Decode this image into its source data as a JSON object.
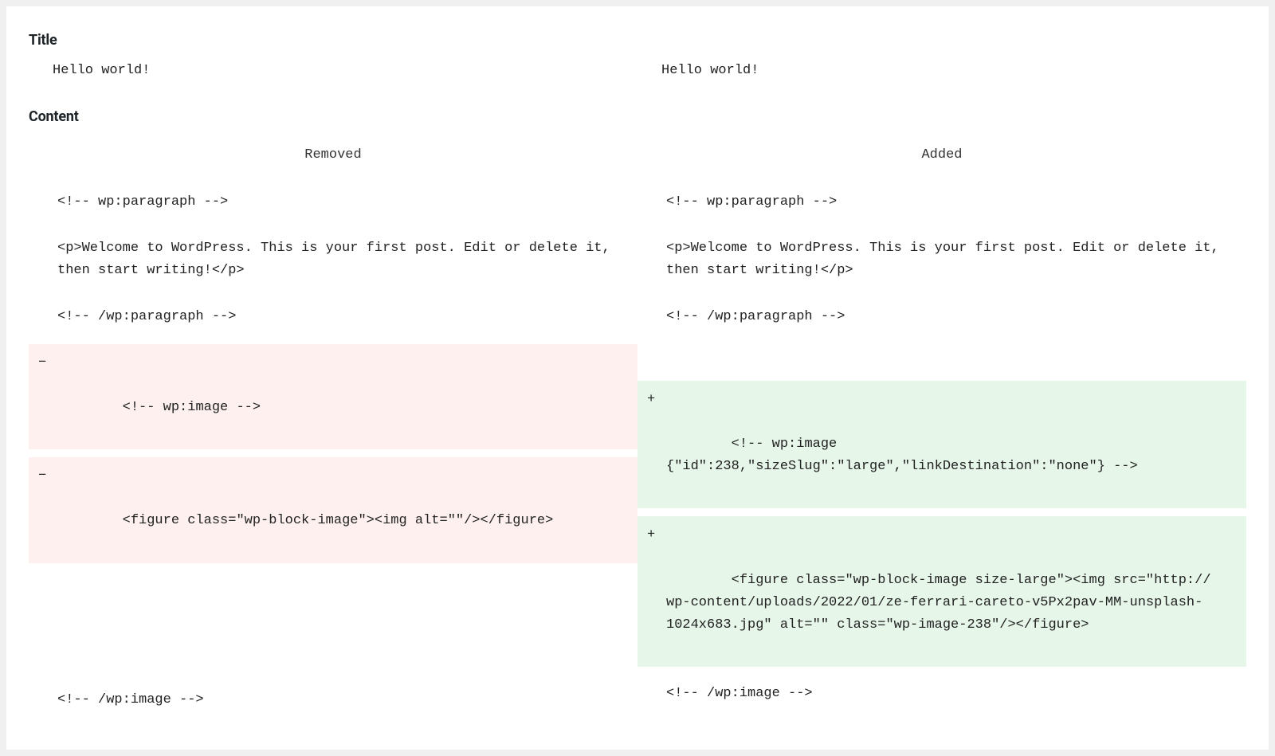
{
  "sections": {
    "title_label": "Title",
    "content_label": "Content"
  },
  "title_row": {
    "left": "Hello world!",
    "right": "Hello world!"
  },
  "diff_headers": {
    "removed": "Removed",
    "added": "Added"
  },
  "markers": {
    "minus": "−",
    "plus": "+"
  },
  "diff": {
    "left": [
      {
        "type": "context",
        "text": "<!-- wp:paragraph -->"
      },
      {
        "type": "context",
        "text": "<p>Welcome to WordPress. This is your first post. Edit or delete it, then start writing!</p>"
      },
      {
        "type": "context",
        "text": "<!-- /wp:paragraph -->"
      },
      {
        "type": "removed",
        "text": "<!-- wp:image -->"
      },
      {
        "type": "removed",
        "text": "<figure class=\"wp-block-image\"><img alt=\"\"/></figure>"
      },
      {
        "type": "spacer"
      },
      {
        "type": "context",
        "text": "<!-- /wp:image -->"
      }
    ],
    "right": [
      {
        "type": "context",
        "text": "<!-- wp:paragraph -->"
      },
      {
        "type": "context",
        "text": "<p>Welcome to WordPress. This is your first post. Edit or delete it, then start writing!</p>"
      },
      {
        "type": "context",
        "text": "<!-- /wp:paragraph -->"
      },
      {
        "type": "spacer_small"
      },
      {
        "type": "added",
        "text": "<!-- wp:image {\"id\":238,\"sizeSlug\":\"large\",\"linkDestination\":\"none\"} -->"
      },
      {
        "type": "added",
        "text": "<figure class=\"wp-block-image size-large\"><img src=\"http://              wp-content/uploads/2022/01/ze-ferrari-careto-v5Px2pav-MM-unsplash-1024x683.jpg\" alt=\"\" class=\"wp-image-238\"/></figure>"
      },
      {
        "type": "context",
        "text": "<!-- /wp:image -->"
      }
    ]
  }
}
